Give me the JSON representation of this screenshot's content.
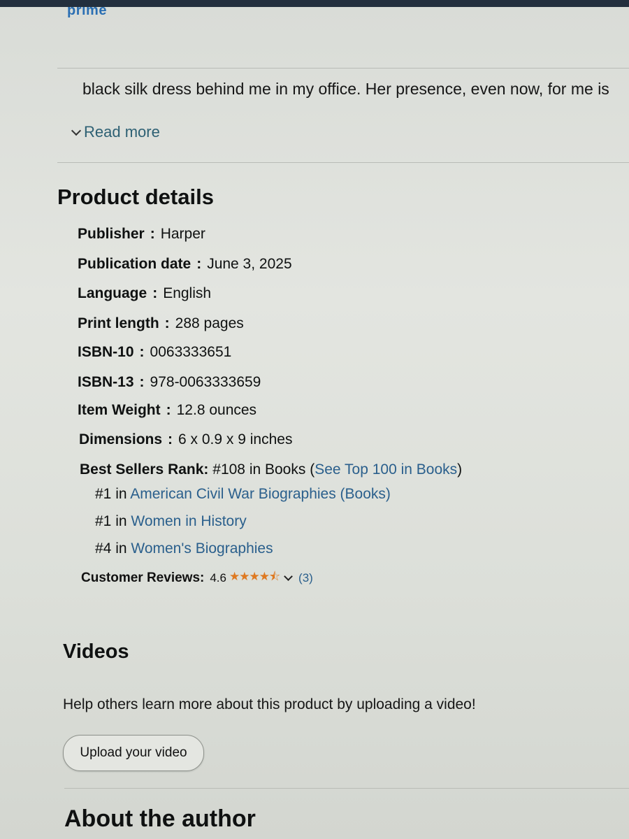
{
  "header": {
    "logo_text": "prime"
  },
  "description": {
    "excerpt": "black silk dress behind me in my office. Her presence, even now, for me is",
    "read_more": "Read more"
  },
  "product_details": {
    "title": "Product details",
    "rows": [
      {
        "label": "Publisher",
        "value": "Harper"
      },
      {
        "label": "Publication date",
        "value": "June 3, 2025"
      },
      {
        "label": "Language",
        "value": "English"
      },
      {
        "label": "Print length",
        "value": "288 pages"
      },
      {
        "label": "ISBN-10",
        "value": "0063333651"
      },
      {
        "label": "ISBN-13",
        "value": "978-0063333659"
      },
      {
        "label": "Item Weight",
        "value": "12.8 ounces"
      },
      {
        "label": "Dimensions",
        "value": "6 x 0.9 x 9 inches"
      }
    ],
    "separator": ":",
    "best_sellers": {
      "label": "Best Sellers Rank:",
      "overall": "#108 in Books (",
      "top100_link": "See Top 100 in Books",
      "close_paren": ")",
      "sub_ranks": [
        {
          "rank": "#1 in",
          "category": "American Civil War Biographies (Books)"
        },
        {
          "rank": "#1 in",
          "category": "Women in History"
        },
        {
          "rank": "#4 in",
          "category": "Women's Biographies"
        }
      ]
    },
    "customer_reviews": {
      "label": "Customer Reviews:",
      "rating": "4.6",
      "rating_value": 4.6,
      "stars": "★★★★⯪",
      "count": "(3)",
      "star_color": "#de7921"
    }
  },
  "videos": {
    "title": "Videos",
    "help_text": "Help others learn more about this product by uploading a video!",
    "upload_button": "Upload your video"
  },
  "about_author": {
    "title": "About the author"
  },
  "colors": {
    "link": "#2a5f8c",
    "text": "#0f1111",
    "star": "#de7921"
  }
}
